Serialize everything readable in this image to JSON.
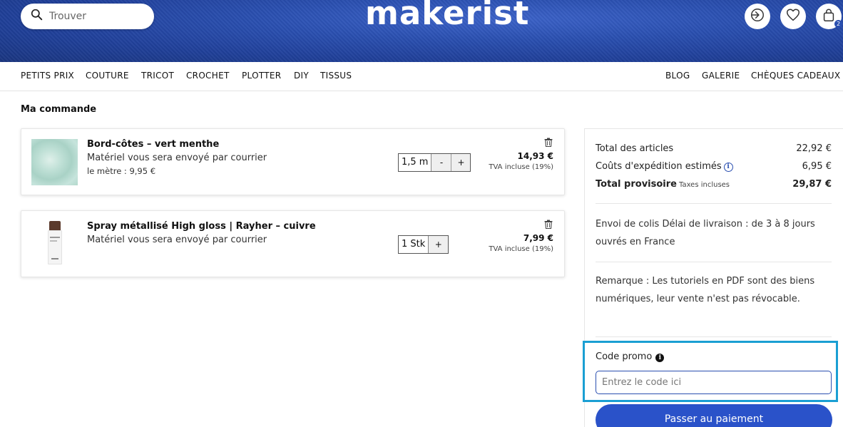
{
  "header": {
    "search_placeholder": "Trouver",
    "logo": "makerist",
    "cart_count": "2",
    "brand_color": "#2a4fb0"
  },
  "nav": {
    "left": [
      "PETITS PRIX",
      "COUTURE",
      "TRICOT",
      "CROCHET",
      "PLOTTER",
      "DIY",
      "TISSUS"
    ],
    "right": [
      "BLOG",
      "GALERIE",
      "CHÈQUES CADEAUX"
    ]
  },
  "page_title": "Ma commande",
  "items": [
    {
      "title": "Bord-côtes – vert menthe",
      "line1": "Matériel vous sera envoyé par courrier",
      "line2": "le mètre : 9,95 €",
      "qty": "1,5 m",
      "minus": "-",
      "plus": "+",
      "price": "14,93 €",
      "vat": "TVA incluse (19%)"
    },
    {
      "title": "Spray métallisé High gloss | Rayher – cuivre",
      "line1": "Matériel vous sera envoyé par courrier",
      "qty": "1 Stk",
      "plus": "+",
      "price": "7,99 €",
      "vat": "TVA incluse (19%)"
    }
  ],
  "summary": {
    "articles_label": "Total des articles",
    "articles_value": "22,92 €",
    "shipping_label": "Coûts d'expédition estimés",
    "shipping_value": "6,95 €",
    "total_label": "Total provisoire",
    "total_note": "Taxes incluses",
    "total_value": "29,87 €",
    "delivery_text": "Envoi de colis Délai de livraison : de 3 à 8 jours ouvrés en France",
    "remark_text": "Remarque : Les tutoriels en PDF sont des biens numériques, leur vente n'est pas révocable.",
    "promo_label": "Code promo",
    "promo_placeholder": "Entrez le code ici",
    "pay_button": "Passer au paiement",
    "highlight_color": "#1a9fd3"
  }
}
